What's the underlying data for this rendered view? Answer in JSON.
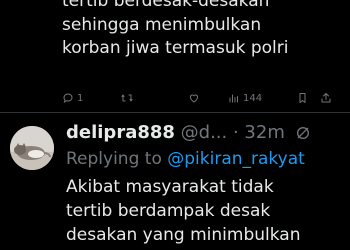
{
  "previous_tweet": {
    "text": "tertib berdesak-desakan\nsehingga menimbulkan\nkorban jiwa termasuk polri",
    "reply_count": "1",
    "view_count": "144"
  },
  "tweet": {
    "display_name": "delipra888",
    "handle_time": "@d... · 32m",
    "replying_prefix": "Replying to ",
    "replying_to": "@pikiran_rakyat",
    "text": "Akibat masyarakat tidak\ntertib berdampak desak\ndesakan yang minimbulkan"
  },
  "colors": {
    "background": "#000000",
    "text": "#e7e9ea",
    "muted": "#71767b",
    "link": "#1d9bf0",
    "divider": "#2f3336"
  },
  "icons": {
    "reply": "reply-icon",
    "retweet": "retweet-icon",
    "like": "like-icon",
    "views": "views-icon",
    "share": "share-icon",
    "grok": "grok-icon"
  }
}
